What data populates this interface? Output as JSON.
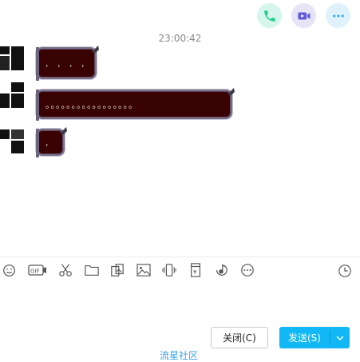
{
  "header": {
    "actions": [
      {
        "name": "phone-icon",
        "color": "#1fcf8a"
      },
      {
        "name": "video-icon",
        "color": "#6157dc"
      },
      {
        "name": "more-icon",
        "color": "#21a8e8"
      }
    ]
  },
  "conversation": {
    "timestamp": "23:00:42",
    "messages": [
      {
        "text": ", , , ,"
      },
      {
        "text": "。。。。。。。。。。。。。。。。。"
      },
      {
        "text": ","
      }
    ]
  },
  "toolbar": {
    "tools": [
      "emoji-icon",
      "gif-icon",
      "scissors-icon",
      "folder-icon",
      "image-sticker-icon",
      "picture-icon",
      "shake-icon",
      "red-packet-icon",
      "music-icon",
      "more-dots-icon"
    ],
    "gif_label": "GIF",
    "yuan_label": "¥",
    "history": "clock-icon"
  },
  "footer": {
    "close_label": "关闭(C)",
    "send_label": "发送(S)",
    "watermark": "流星社区"
  },
  "colors": {
    "send_button": "#12b7f5",
    "bubble": "#3a0303"
  }
}
